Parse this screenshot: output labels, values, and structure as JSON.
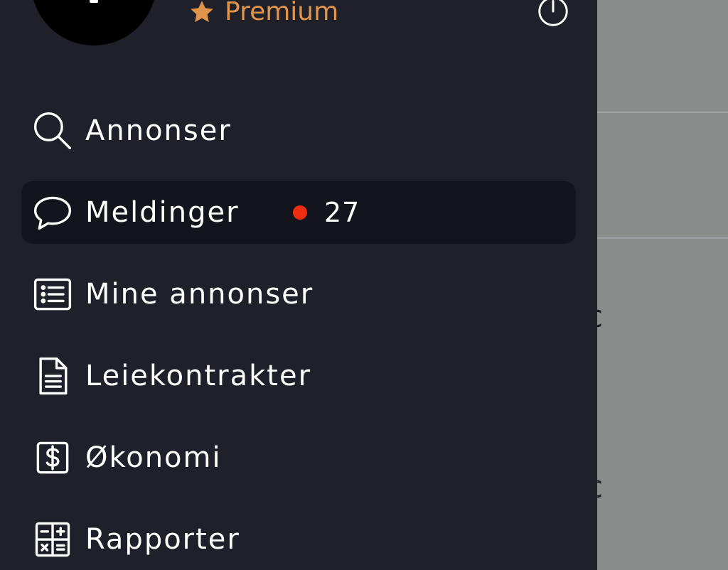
{
  "profile": {
    "plan_label": "Premium"
  },
  "menu": {
    "items": [
      {
        "label": "Annonser",
        "icon": "search-icon"
      },
      {
        "label": "Meldinger",
        "icon": "chat-bubble-icon",
        "badge": "27",
        "active": true
      },
      {
        "label": "Mine annonser",
        "icon": "list-icon"
      },
      {
        "label": "Leiekontrakter",
        "icon": "document-icon"
      },
      {
        "label": "Økonomi",
        "icon": "dollar-icon"
      },
      {
        "label": "Rapporter",
        "icon": "calculator-icon"
      }
    ]
  },
  "colors": {
    "drawer_bg": "#1f2029",
    "active_item_bg": "#14151c",
    "accent": "#e0954b",
    "badge_dot": "#ee2d13",
    "overlay": "#8a8b8b"
  },
  "background": {
    "partial_text_1": "c",
    "partial_text_2": "c"
  }
}
